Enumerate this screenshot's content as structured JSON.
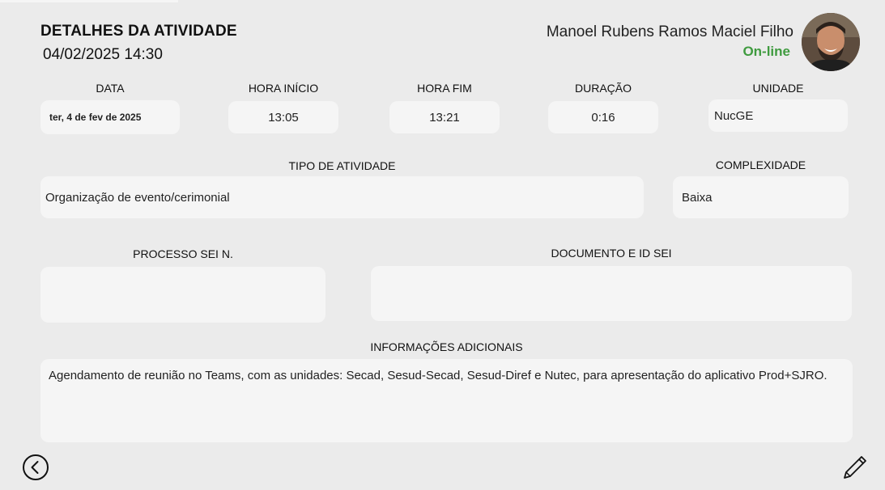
{
  "header": {
    "title": "DETALHES DA ATIVIDADE",
    "datetime": "04/02/2025 14:30",
    "user_name": "Manoel Rubens Ramos Maciel Filho",
    "status": "On-line"
  },
  "fields": {
    "data": {
      "label": "DATA",
      "value": "ter, 4 de fev de 2025"
    },
    "hora_inicio": {
      "label": "HORA INÍCIO",
      "value": "13:05"
    },
    "hora_fim": {
      "label": "HORA FIM",
      "value": "13:21"
    },
    "duracao": {
      "label": "DURAÇÃO",
      "value": "0:16"
    },
    "unidade": {
      "label": "UNIDADE",
      "value": "NucGE"
    },
    "tipo_atividade": {
      "label": "TIPO DE ATIVIDADE",
      "value": "Organização de evento/cerimonial"
    },
    "complexidade": {
      "label": "COMPLEXIDADE",
      "value": "Baixa"
    },
    "processo_sei": {
      "label": "PROCESSO SEI N.",
      "value": ""
    },
    "documento_id_sei": {
      "label": "DOCUMENTO E ID SEI",
      "value": ""
    },
    "informacoes": {
      "label": "INFORMAÇÕES ADICIONAIS",
      "value": "Agendamento de reunião no Teams, com as unidades: Secad, Sesud-Secad, Sesud-Diref e Nutec, para apresentação do aplicativo Prod+SJRO."
    }
  },
  "colors": {
    "status_online": "#3f9b3f",
    "field_bg": "#f5f5f5",
    "page_bg": "#ebebeb"
  },
  "icons": {
    "back": "chevron-left-circle-icon",
    "edit": "pencil-icon"
  }
}
